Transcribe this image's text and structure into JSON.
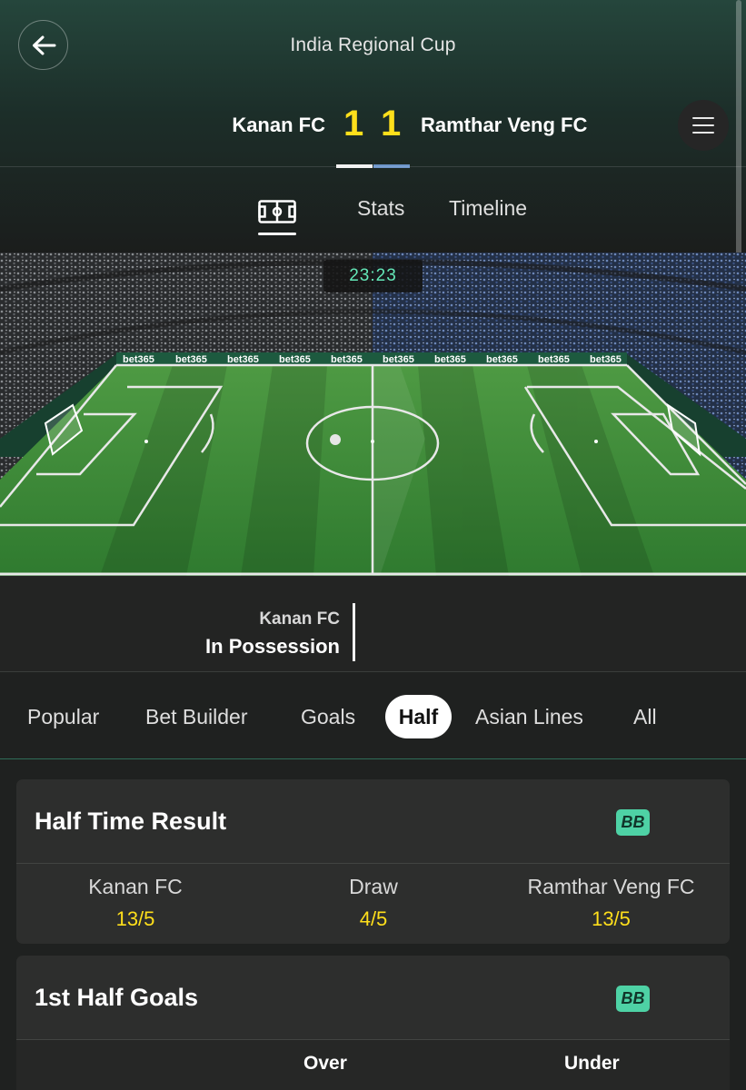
{
  "header": {
    "title": "India Regional Cup",
    "home_team": "Kanan FC",
    "away_team": "Ramthar Veng FC",
    "home_score": "1",
    "away_score": "1"
  },
  "tabs": {
    "stats": "Stats",
    "timeline": "Timeline"
  },
  "pitch": {
    "clock": "23:23",
    "board_text": "bet365"
  },
  "possession": {
    "team": "Kanan FC",
    "label": "In Possession"
  },
  "market_tabs": {
    "popular": "Popular",
    "bet_builder": "Bet Builder",
    "goals": "Goals",
    "half": "Half",
    "asian_lines": "Asian Lines",
    "all": "All"
  },
  "markets": {
    "half_time_result": {
      "title": "Half Time Result",
      "badge": "BB",
      "selections": [
        {
          "name": "Kanan FC",
          "odds": "13/5"
        },
        {
          "name": "Draw",
          "odds": "4/5"
        },
        {
          "name": "Ramthar Veng FC",
          "odds": "13/5"
        }
      ]
    },
    "first_half_goals": {
      "title": "1st Half Goals",
      "badge": "BB",
      "col_over": "Over",
      "col_under": "Under"
    }
  },
  "colors": {
    "score": "#ffdf1b",
    "odds": "#ffdf1b",
    "clock": "#64e8b8",
    "bb_badge": "#4ed2a5",
    "home_bar": "#f1f1f1",
    "away_bar": "#6d95c9"
  }
}
